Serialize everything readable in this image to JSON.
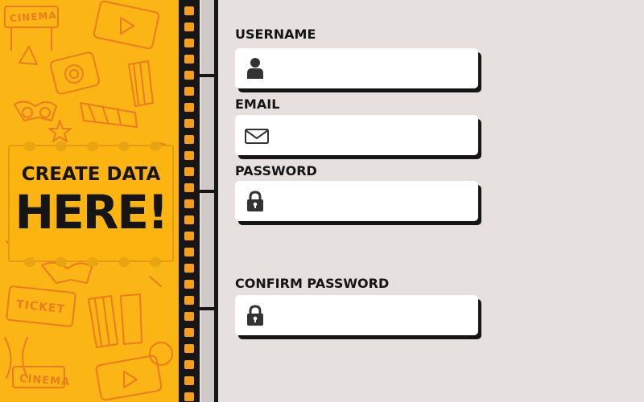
{
  "doodles": {
    "cinema_top": "CINEMA",
    "ticket": "TICKET",
    "cinema_bottom": "CINEMA"
  },
  "sign": {
    "line1": "CREATE DATA",
    "line2": "HERE!"
  },
  "form": {
    "username": {
      "label": "USERNAME",
      "value": "",
      "icon": "user-icon"
    },
    "email": {
      "label": "EMAIL",
      "value": "",
      "icon": "envelope-icon"
    },
    "password": {
      "label": "PASSWORD",
      "value": "",
      "icon": "lock-icon"
    },
    "confirm_password": {
      "label": "CONFIRM PASSWORD",
      "value": "",
      "icon": "lock-icon"
    }
  },
  "colors": {
    "panel": "#fbb514",
    "doodle": "#ea7d1f",
    "film": "#161616",
    "film_hole": "#fb9e17",
    "background": "#e6e0df",
    "text": "#151515"
  }
}
